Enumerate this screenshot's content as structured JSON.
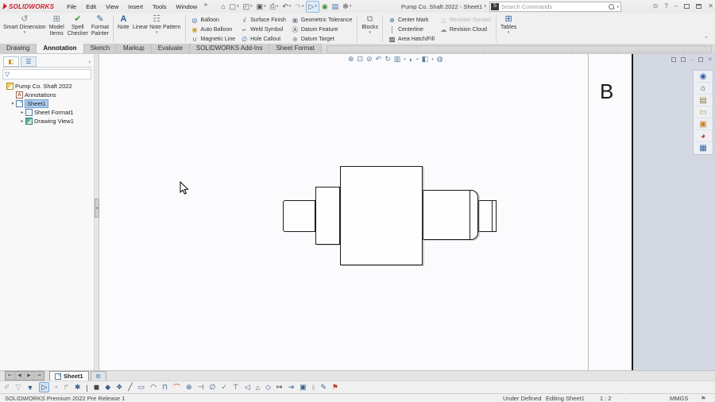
{
  "app": {
    "logo": "SOLIDWORKS",
    "menus": [
      "File",
      "Edit",
      "View",
      "Insert",
      "Tools",
      "Window"
    ],
    "title": "Pump Co. Shaft 2022 - Sheet1 *",
    "search_placeholder": "Search Commands"
  },
  "ribbon": {
    "smart_dimension": "Smart Dimension",
    "model_items_1": "Model",
    "model_items_2": "Items",
    "spell_1": "Spell",
    "spell_2": "Checker",
    "format_1": "Format",
    "format_2": "Painter",
    "note": "Note",
    "linear_note_pattern": "Linear Note Pattern",
    "balloon": "Balloon",
    "auto_balloon": "Auto Balloon",
    "magnetic_line": "Magnetic Line",
    "surface_finish": "Surface Finish",
    "weld_symbol": "Weld Symbol",
    "hole_callout": "Hole Callout",
    "geometric_tolerance": "Geometric Tolerance",
    "datum_feature": "Datum Feature",
    "datum_target": "Datum Target",
    "blocks": "Blocks",
    "center_mark": "Center Mark",
    "centerline": "Centerline",
    "area_hatch": "Area Hatch/Fill",
    "revision_symbol": "Revision Symbol",
    "revision_cloud": "Revision Cloud",
    "tables": "Tables"
  },
  "tabs": [
    "Drawing",
    "Annotation",
    "Sketch",
    "Markup",
    "Evaluate",
    "SOLIDWORKS Add-Ins",
    "Sheet Format"
  ],
  "tree": {
    "root": "Pump Co. Shaft 2022",
    "annotations": "Annotations",
    "sheet": "Sheet1",
    "sheet_format": "Sheet Format1",
    "drawing_view": "Drawing View1"
  },
  "canvas": {
    "zone_letter": "B"
  },
  "sheettabs": {
    "sheet1": "Sheet1"
  },
  "statusbar": {
    "left": "SOLIDWORKS Premium 2022 Pre Release 1",
    "defined": "Under Defined",
    "editing": "Editing Sheet1",
    "scale": "1 : 2",
    "units": "MMGS",
    "sep": "·"
  },
  "colors": {
    "accent": "#d11f2f",
    "selection": "#aecdf0",
    "canvas": "#d3d8e2"
  },
  "glyphs": {
    "pin": "➤",
    "caret": "▾",
    "chev": "›",
    "collapse": "⌃",
    "account": "⊙",
    "help": "?",
    "minimize": "–",
    "close": "✕",
    "qa": {
      "home": "⌂",
      "new": "▢",
      "open": "◰",
      "save": "▣",
      "print": "⎙",
      "undo": "↶",
      "redo": "↷",
      "select": "▷",
      "rebuild": "◉",
      "fileprops": "▤",
      "options": "✻"
    },
    "hud": {
      "zoom_fit": "⊕",
      "zoom_area": "⊡",
      "zoom": "⊘",
      "prev_view": "↶",
      "rotate": "↻",
      "section": "▥",
      "view_settings": "◐",
      "display_style": "◧",
      "hide_show": "◍"
    },
    "ribbon": {
      "smart_dimension": "↺",
      "model_items": "⊞",
      "spell": "✔",
      "format_painter": "✎",
      "note": "A",
      "linear_note": "☷",
      "balloon": "◎",
      "auto_balloon": "◉",
      "magnetic": "∪",
      "surface": "√",
      "weld": "⌐",
      "hole": "∅",
      "geo": "▣",
      "datum_feature": "Ⓐ",
      "datum_target": "⊕",
      "blocks": "⧉",
      "center_mark": "⊕",
      "centerline": "┆",
      "hatch": "▨",
      "rev_symbol": "△",
      "rev_cloud": "☁",
      "tables": "⊞"
    },
    "tree_tabs": {
      "feature_manager": "◧",
      "property_manager": "☰"
    },
    "filter": "▽",
    "expand": "▸",
    "expanded": "▾",
    "nav": {
      "first": "⇤",
      "prev": "◀",
      "next": "▶",
      "last": "⇥"
    },
    "addtab": "⧉",
    "taskpane": {
      "content3d": "◉",
      "resources": "⌂",
      "library": "▤",
      "explorer": "▭",
      "palette": "▣",
      "appearances": "◕",
      "properties": "▦"
    },
    "docwin": {
      "dash": "–",
      "x": "✕"
    },
    "tag": "⚑",
    "bottom": [
      "✐",
      "▽",
      "▼",
      "▷",
      "▾",
      "↱",
      "✱",
      "|",
      "◼",
      "◆",
      "❖",
      "╱",
      "▭",
      "◠",
      "⊓",
      "⌒",
      "⊕",
      "⊣",
      "∅",
      "✓",
      "⊤",
      "◁",
      "⌂",
      "◇",
      "↦",
      "⇥",
      "▣",
      "‖",
      "✎",
      "⚑"
    ]
  }
}
